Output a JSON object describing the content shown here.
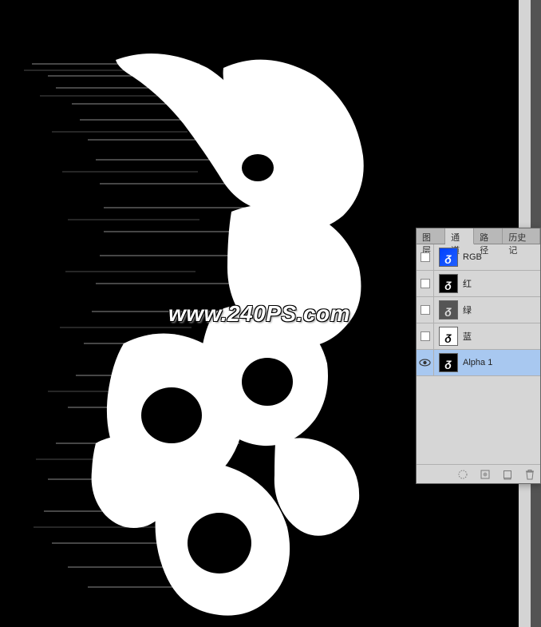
{
  "watermark": "www.240PS.com",
  "panel": {
    "tabs": [
      {
        "label": "图层",
        "active": false
      },
      {
        "label": "通道",
        "active": true
      },
      {
        "label": "路径",
        "active": false
      },
      {
        "label": "历史记",
        "active": false
      }
    ],
    "channels": [
      {
        "name": "RGB",
        "visible": false,
        "selected": false,
        "thumb": "rgb"
      },
      {
        "name": "红",
        "visible": false,
        "selected": false,
        "thumb": "red"
      },
      {
        "name": "绿",
        "visible": false,
        "selected": false,
        "thumb": "green"
      },
      {
        "name": "蓝",
        "visible": false,
        "selected": false,
        "thumb": "blue"
      },
      {
        "name": "Alpha 1",
        "visible": true,
        "selected": true,
        "thumb": "alpha"
      }
    ]
  }
}
